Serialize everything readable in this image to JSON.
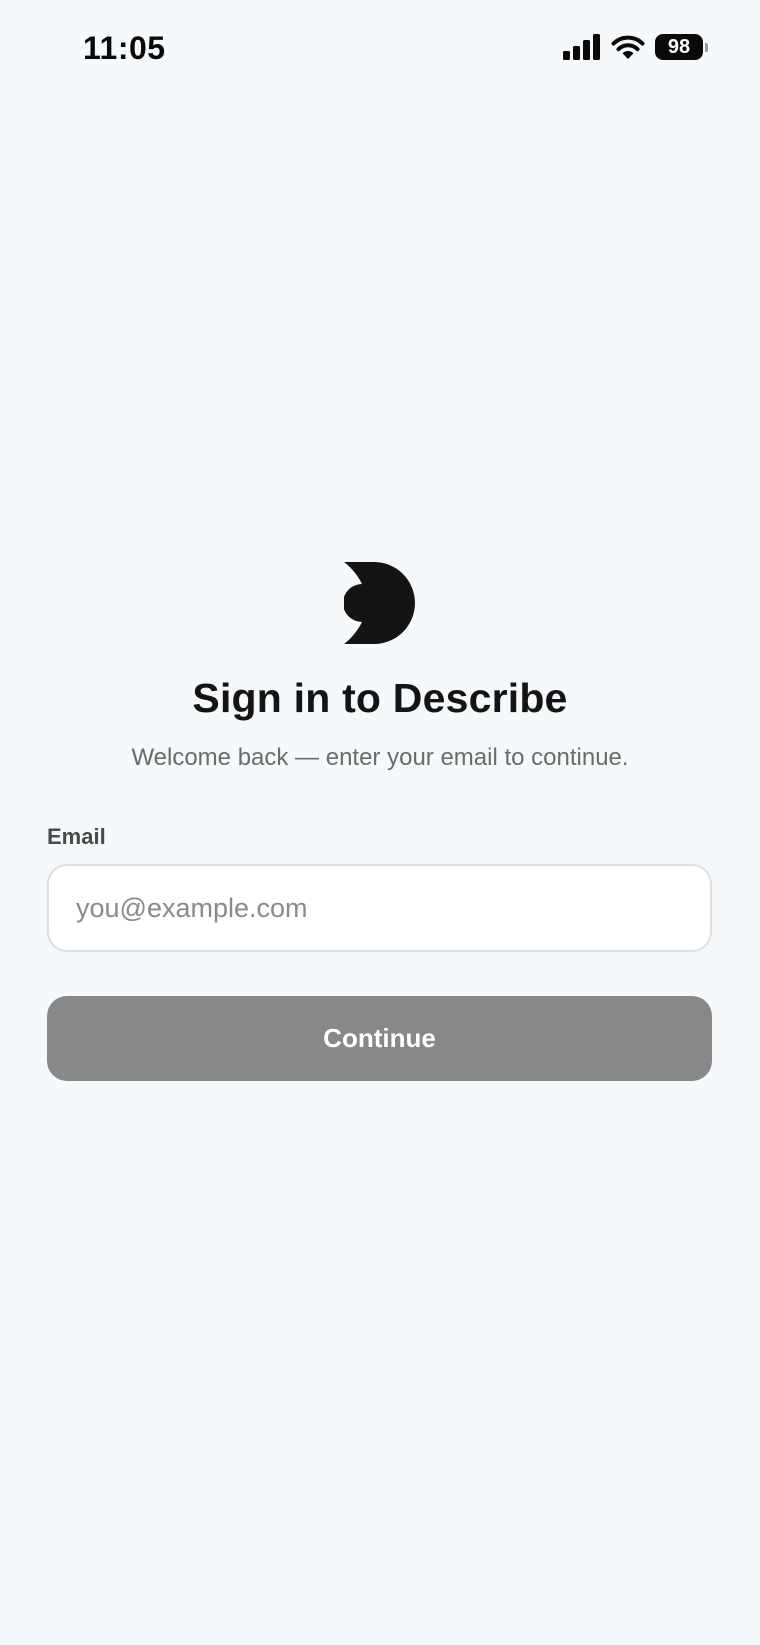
{
  "status_bar": {
    "time": "11:05",
    "battery_level": "98",
    "icons": [
      "signal-bars-icon",
      "wifi-icon",
      "battery-icon"
    ]
  },
  "brand": {
    "logo_icon": "describe-logo-icon",
    "color": "#141414"
  },
  "signin": {
    "title": "Sign in to Describe",
    "subtitle": "Welcome back — enter your email to continue.",
    "email_label": "Email",
    "email_value": "",
    "email_placeholder": "you@example.com",
    "continue_label": "Continue"
  },
  "colors": {
    "background": "#f6f9fb",
    "button_disabled": "#888888",
    "input_border": "#dedede"
  }
}
